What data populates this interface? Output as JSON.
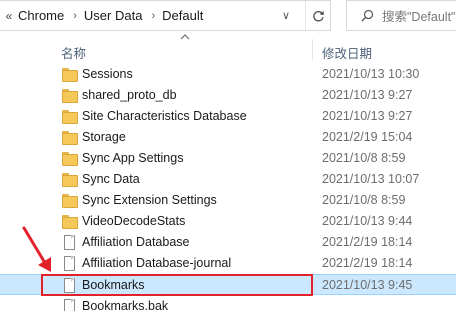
{
  "address_bar": {
    "overflow_glyph": "«",
    "crumbs": [
      {
        "label": "Chrome"
      },
      {
        "label": "User Data"
      },
      {
        "label": "Default"
      }
    ],
    "separator_glyph": "›",
    "dropdown_glyph": "∨",
    "refresh_icon": "refresh-icon"
  },
  "search": {
    "icon": "search-icon",
    "placeholder": "搜索\"Default\""
  },
  "columns": {
    "name": "名称",
    "date": "修改日期",
    "sort_direction": "ascending"
  },
  "files": [
    {
      "name": "Sessions",
      "date": "2021/10/13 10:30",
      "type": "folder"
    },
    {
      "name": "shared_proto_db",
      "date": "2021/10/13 9:27",
      "type": "folder"
    },
    {
      "name": "Site Characteristics Database",
      "date": "2021/10/13 9:27",
      "type": "folder"
    },
    {
      "name": "Storage",
      "date": "2021/2/19 15:04",
      "type": "folder"
    },
    {
      "name": "Sync App Settings",
      "date": "2021/10/8 8:59",
      "type": "folder"
    },
    {
      "name": "Sync Data",
      "date": "2021/10/13 10:07",
      "type": "folder"
    },
    {
      "name": "Sync Extension Settings",
      "date": "2021/10/8 8:59",
      "type": "folder"
    },
    {
      "name": "VideoDecodeStats",
      "date": "2021/10/13 9:44",
      "type": "folder"
    },
    {
      "name": "Affiliation Database",
      "date": "2021/2/19 18:14",
      "type": "file"
    },
    {
      "name": "Affiliation Database-journal",
      "date": "2021/2/19 18:14",
      "type": "file"
    },
    {
      "name": "Bookmarks",
      "date": "2021/10/13 9:45",
      "type": "file",
      "selected": true
    },
    {
      "name": "Bookmarks.bak",
      "date": "",
      "type": "file"
    }
  ],
  "annotation": {
    "highlight_color": "#e2222b",
    "target": "Bookmarks"
  },
  "colors": {
    "selection_bg": "#cce8ff",
    "selection_border": "#99d1ff",
    "header_text": "#4c607a",
    "folder": "#f5c85a"
  }
}
